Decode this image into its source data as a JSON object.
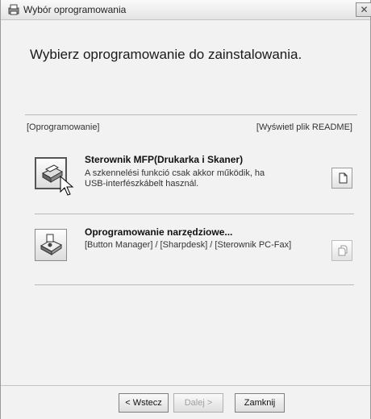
{
  "window": {
    "title": "Wybór oprogramowania",
    "close_glyph": "✕"
  },
  "heading": "Wybierz oprogramowanie do zainstalowania.",
  "header": {
    "left": "[Oprogramowanie]",
    "right": "[Wyświetl plik README]"
  },
  "items": [
    {
      "title": "Sterownik MFP(Drukarka i Skaner)",
      "desc_line1": "A szkennelési funkció csak akkor működik, ha",
      "desc_line2": "USB-interfészkábelt használ.",
      "icon": "printer-scanner-icon",
      "readme_icon": "document-icon"
    },
    {
      "title": "Oprogramowanie narzędziowe...",
      "desc_line1": "[Button Manager] / [Sharpdesk] / [Sterownik PC-Fax]",
      "icon": "utility-software-icon",
      "readme_icon": "documents-icon"
    }
  ],
  "buttons": {
    "back": "< Wstecz",
    "next": "Dalej >",
    "close": "Zamknij"
  }
}
